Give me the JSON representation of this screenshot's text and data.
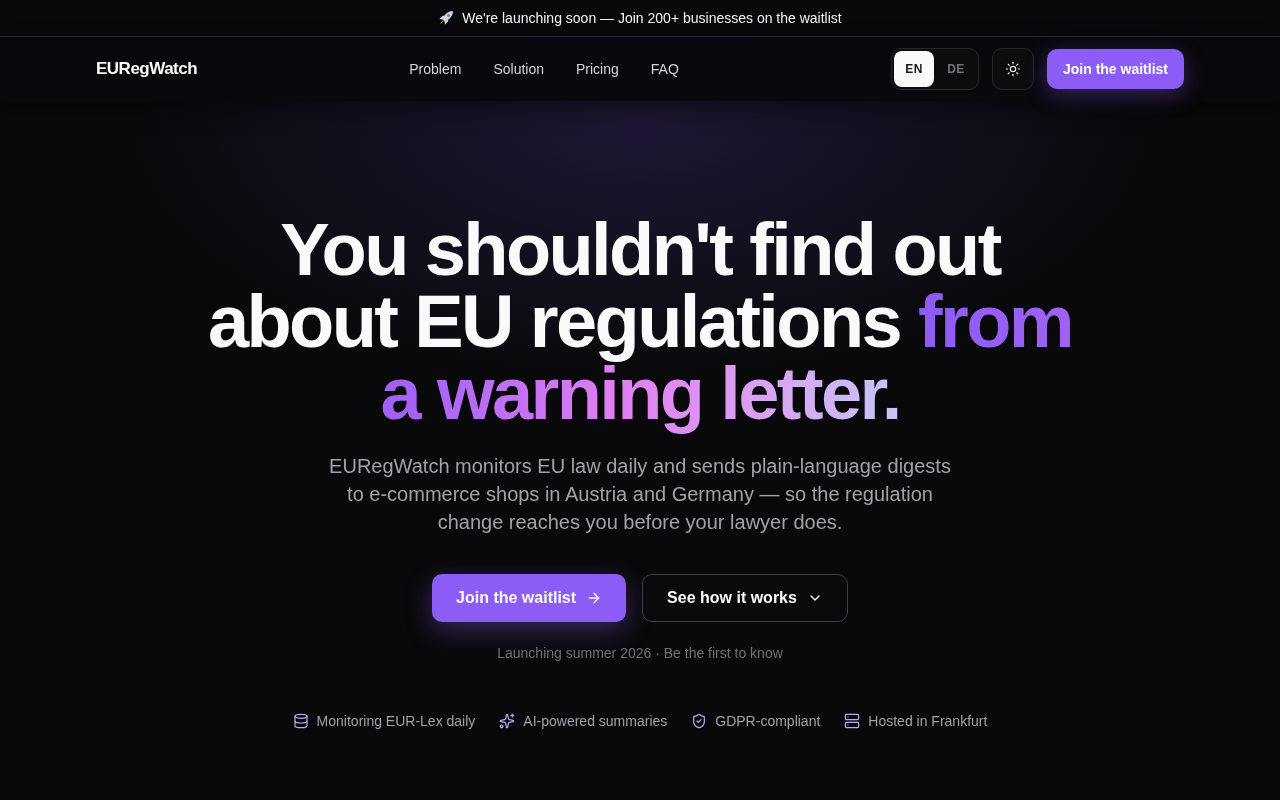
{
  "banner": {
    "text": "We're launching soon — Join 200+ businesses on the waitlist"
  },
  "nav": {
    "logo": "EURegWatch",
    "links": [
      {
        "label": "Problem"
      },
      {
        "label": "Solution"
      },
      {
        "label": "Pricing"
      },
      {
        "label": "FAQ"
      }
    ],
    "languages": [
      {
        "label": "EN",
        "selected": true
      },
      {
        "label": "DE",
        "selected": false
      }
    ],
    "cta": "Join the waitlist"
  },
  "hero": {
    "headline": {
      "text": "You shouldn't find out about EU regulations",
      "highlight": "from a warning letter."
    },
    "description": "EURegWatch monitors EU law daily and sends plain-language digests to e-commerce shops in Austria and Germany — so the regulation change reaches you before your lawyer does.",
    "buttons": [
      {
        "label": "Join the waitlist",
        "kind": "primary"
      },
      {
        "label": "See how it works",
        "kind": "secondary"
      }
    ],
    "note": "Launching summer 2026 · Be the first to know",
    "features": [
      {
        "label": "Monitoring EUR-Lex daily"
      },
      {
        "label": "AI-powered summaries"
      },
      {
        "label": "GDPR-compliant"
      },
      {
        "label": "Hosted in Frankfurt"
      }
    ]
  }
}
